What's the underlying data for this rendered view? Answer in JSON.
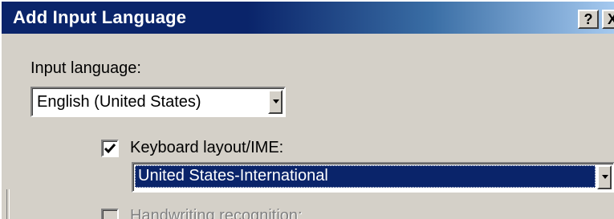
{
  "window": {
    "title": "Add Input Language",
    "help_label": "?",
    "close_label": "X"
  },
  "input_language": {
    "label": "Input language:",
    "value": "English (United States)"
  },
  "keyboard_layout": {
    "checked": true,
    "label": "Keyboard layout/IME:",
    "value": "United States-International"
  },
  "handwriting": {
    "checked": false,
    "enabled": false,
    "label": "Handwriting recognition:"
  },
  "icons": {
    "dropdown": "chevron-down-icon",
    "check": "check-icon"
  },
  "colors": {
    "title_bar": "#0a246a",
    "selection": "#0a246a",
    "face": "#d4d0c8"
  }
}
